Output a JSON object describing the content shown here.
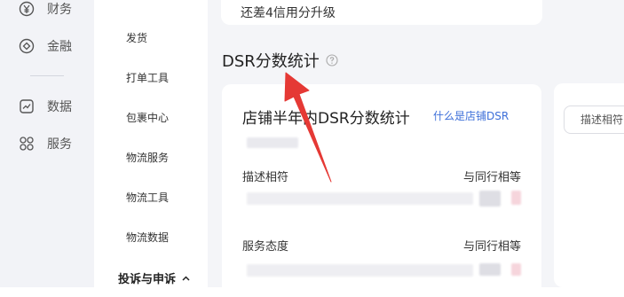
{
  "primary_nav": {
    "items": [
      {
        "label": "财务",
        "icon": "yen-circle-icon"
      },
      {
        "label": "金融",
        "icon": "diamond-circle-icon"
      },
      {
        "label": "数据",
        "icon": "trend-chart-icon"
      },
      {
        "label": "服务",
        "icon": "grid-apps-icon"
      }
    ]
  },
  "secondary_nav": {
    "items": [
      "发货",
      "打单工具",
      "包裹中心",
      "物流服务",
      "物流工具",
      "物流数据"
    ],
    "group_label": "投诉与申诉"
  },
  "top_card": {
    "text": "还差4信用分升级"
  },
  "section": {
    "title": "DSR分数统计"
  },
  "dsr_card": {
    "title": "店铺半年内DSR分数统计",
    "help_link": "什么是店铺DSR",
    "rows": [
      {
        "label": "描述相符",
        "compare": "与同行相等"
      },
      {
        "label": "服务态度",
        "compare": "与同行相等"
      }
    ]
  },
  "right_panel": {
    "tab_label": "描述相符"
  },
  "colors": {
    "link": "#3d6fd9",
    "arrow": "#e53935",
    "sidebar_bg": "#f2f3f7",
    "main_bg": "#f4f5f8"
  }
}
